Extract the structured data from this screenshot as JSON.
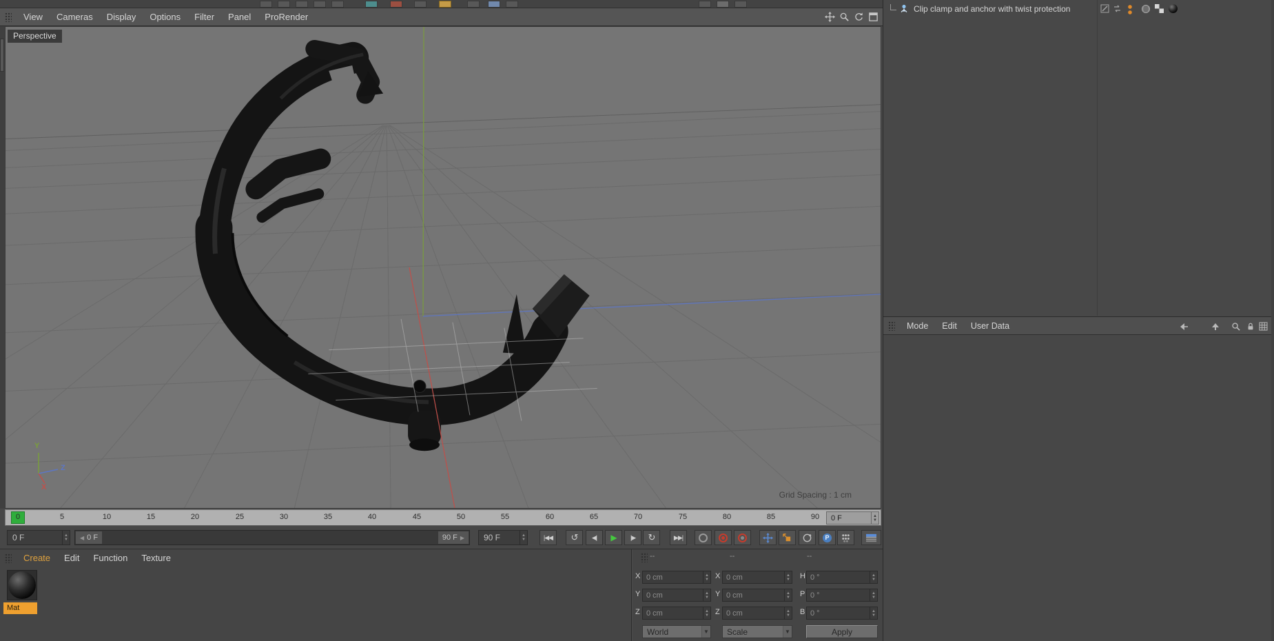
{
  "colors": {
    "accent_orange": "#efa02f",
    "play_green": "#45c93f",
    "record_red": "#c63b2c",
    "axis_x_red": "#c0504a",
    "axis_y_green": "#7a9e3b",
    "axis_z_blue": "#5d76c4",
    "viewport_bg": "#757575"
  },
  "icons": {
    "viewport_nav": [
      "pan-icon",
      "dolly-icon",
      "rotate-icon",
      "toggle-view-icon"
    ],
    "record": [
      "keyframe-selection-icon",
      "record-active-icon",
      "autokey-icon"
    ],
    "keying": [
      "position-icon",
      "scale-icon",
      "rotation-icon",
      "parameter-icon",
      "point-level-icon"
    ],
    "attribute_bar": [
      "back-icon",
      "up-icon",
      "search-icon",
      "lock-icon",
      "grid-icon"
    ],
    "object_tags": [
      "visibility-dots-icon",
      "phong-icon",
      "texture-checker-icon",
      "material-sphere-icon"
    ]
  },
  "viewport_menu": {
    "items": [
      "View",
      "Cameras",
      "Display",
      "Options",
      "Filter",
      "Panel",
      "ProRender"
    ]
  },
  "viewport": {
    "camera_label": "Perspective",
    "grid_spacing_label": "Grid Spacing : 1 cm",
    "axis_x": "X",
    "axis_y": "Y",
    "axis_z": "Z"
  },
  "timeline": {
    "ticks": [
      "0",
      "5",
      "10",
      "15",
      "20",
      "25",
      "30",
      "35",
      "40",
      "45",
      "50",
      "55",
      "60",
      "65",
      "70",
      "75",
      "80",
      "85",
      "90"
    ],
    "frame_field": "0 F"
  },
  "transport": {
    "current_frame": "0 F",
    "range_start": "0 F",
    "range_end": "90 F",
    "end_frame": "90 F",
    "buttons": [
      "|◀◀",
      "↺",
      "◀|",
      "▶",
      "|▶",
      "↻",
      "▶▶|"
    ],
    "param_icon_label": "P"
  },
  "materials": {
    "menu": [
      "Create",
      "Edit",
      "Function",
      "Texture"
    ],
    "items": [
      {
        "name": "Mat"
      }
    ]
  },
  "coordinates": {
    "headers": [
      "--",
      "--",
      "--"
    ],
    "rows": [
      {
        "labels": [
          "X",
          "X",
          "H"
        ],
        "values": [
          "0 cm",
          "0 cm",
          "0 °"
        ]
      },
      {
        "labels": [
          "Y",
          "Y",
          "P"
        ],
        "values": [
          "0 cm",
          "0 cm",
          "0 °"
        ]
      },
      {
        "labels": [
          "Z",
          "Z",
          "B"
        ],
        "values": [
          "0 cm",
          "0 cm",
          "0 °"
        ]
      }
    ],
    "space_dropdown": "World",
    "mode_dropdown": "Scale",
    "apply_button": "Apply"
  },
  "object_manager": {
    "objects": [
      {
        "name": "Clip clamp and anchor with twist protection"
      }
    ]
  },
  "attribute_manager": {
    "menu": [
      "Mode",
      "Edit",
      "User Data"
    ]
  }
}
